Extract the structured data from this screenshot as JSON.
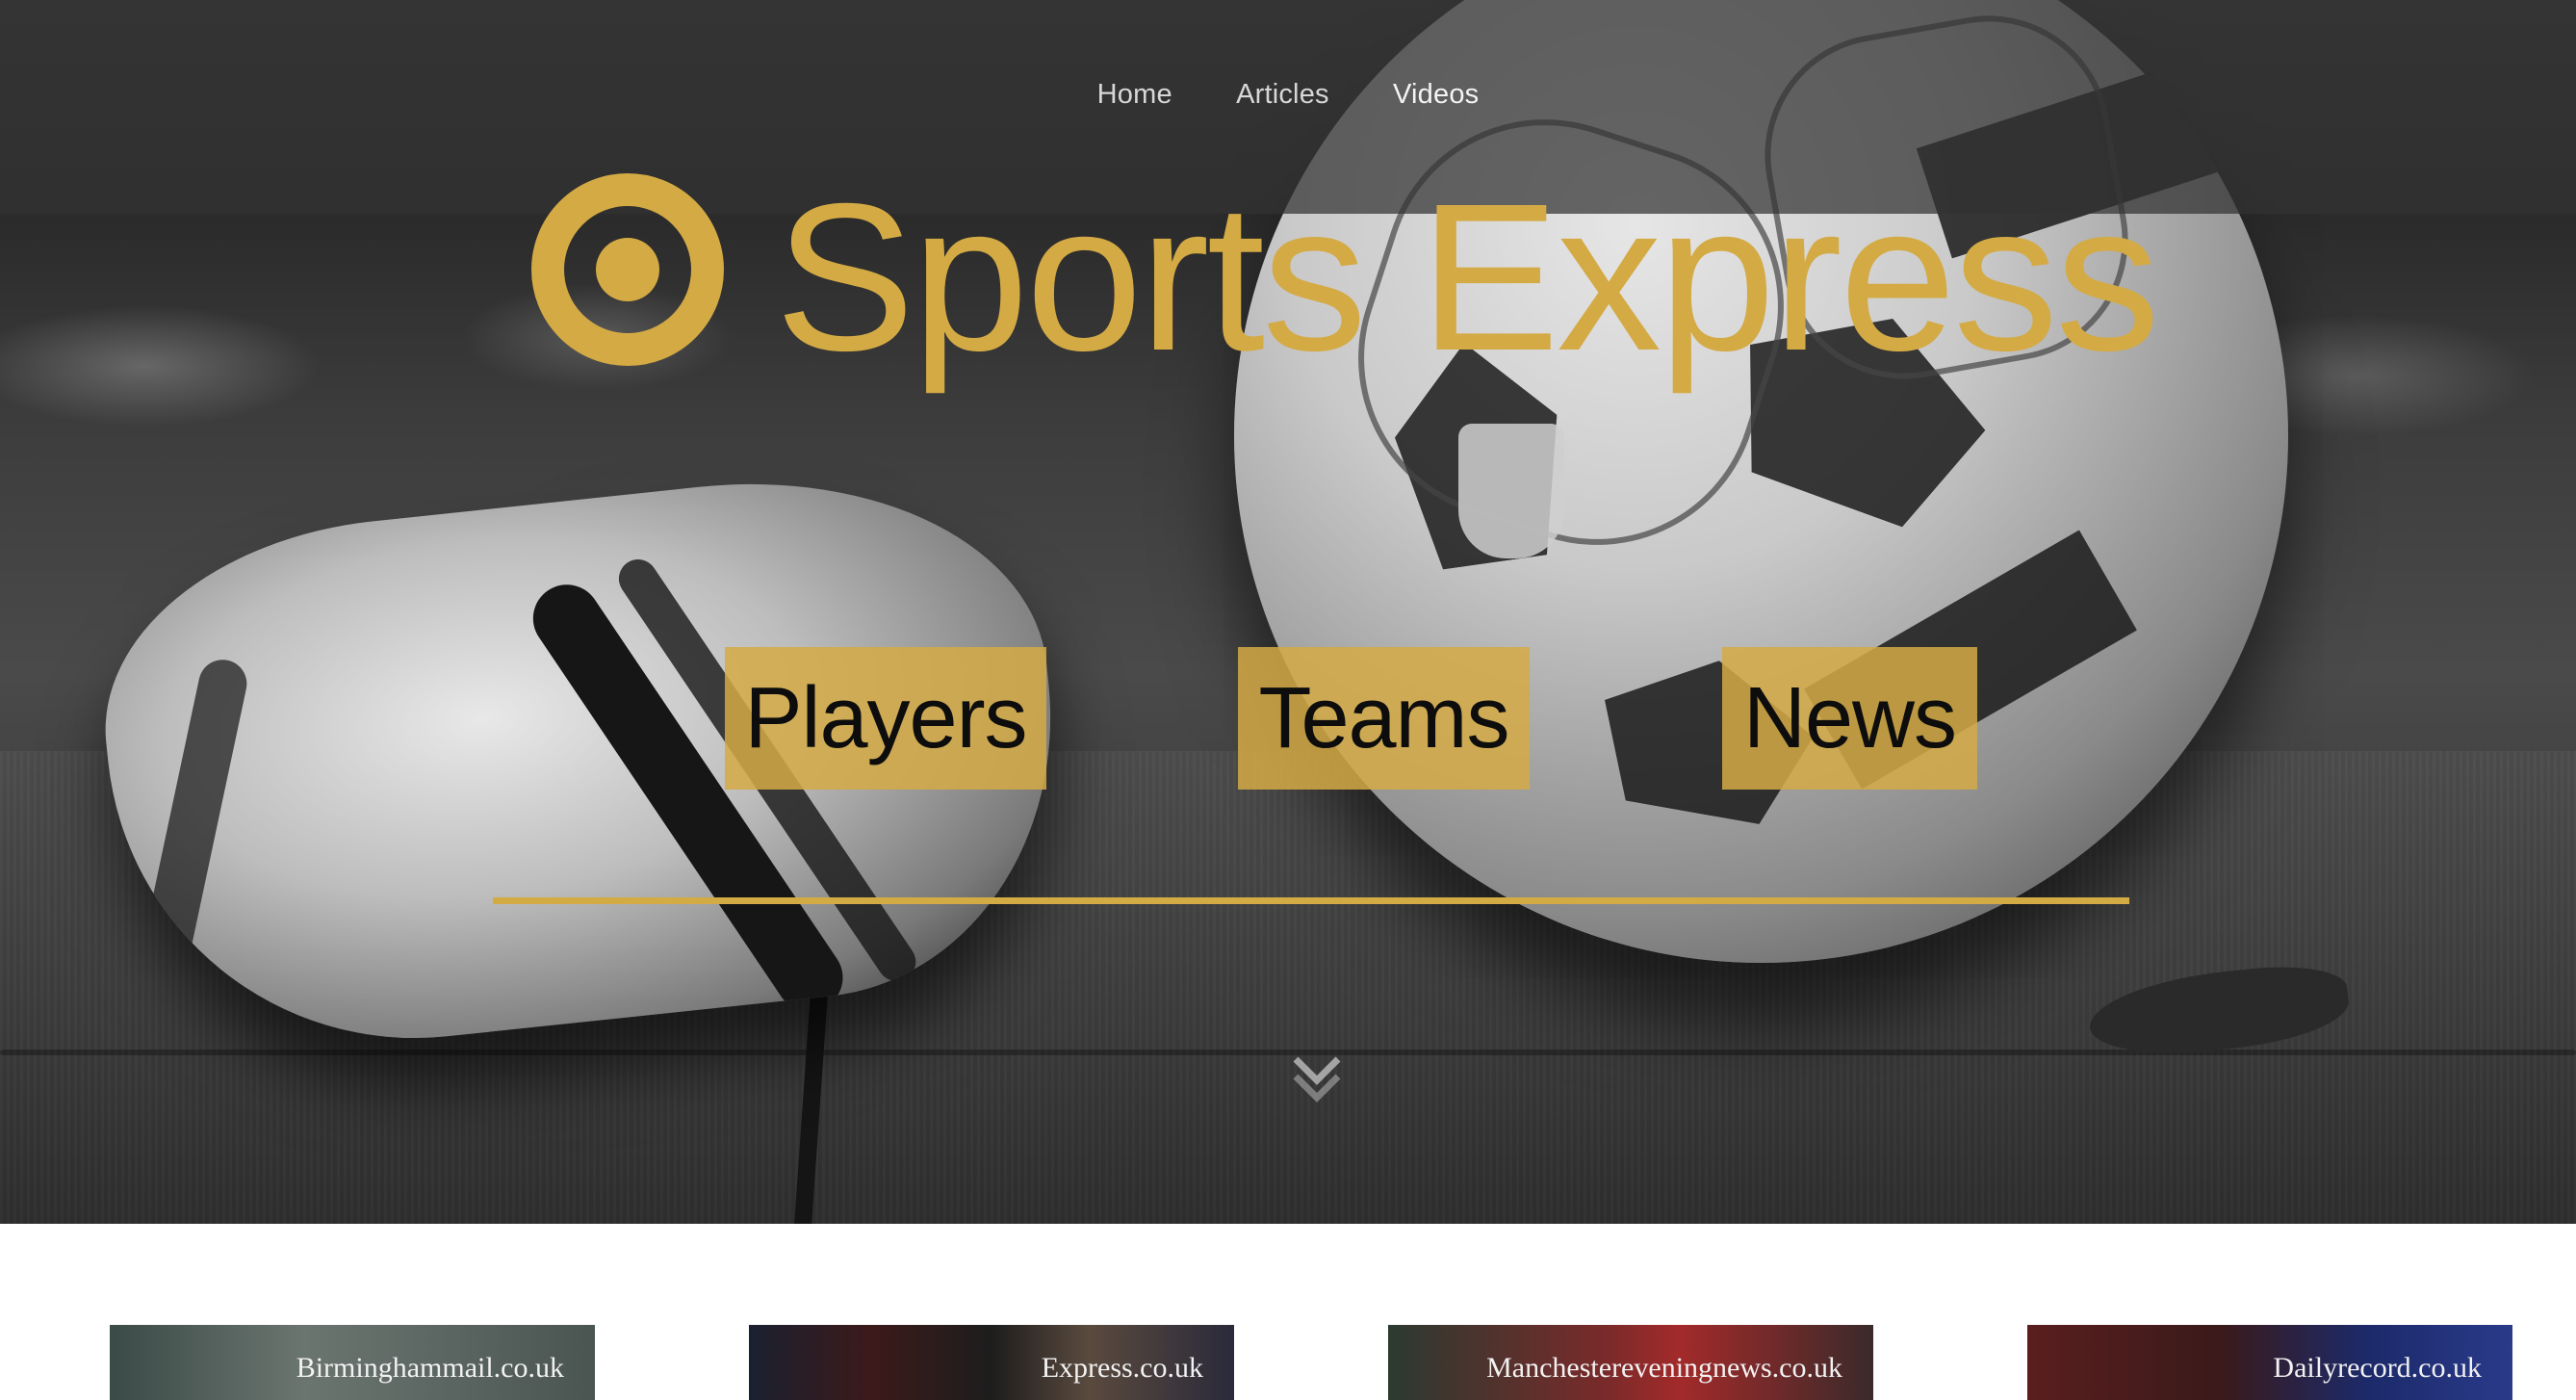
{
  "nav": {
    "items": [
      {
        "label": "Home"
      },
      {
        "label": "Articles"
      },
      {
        "label": "Videos"
      }
    ]
  },
  "brand": {
    "title": "Sports Express",
    "logo_icon": "target-icon",
    "accent_color": "#d4aa44"
  },
  "categories": [
    {
      "label": "Players"
    },
    {
      "label": "Teams"
    },
    {
      "label": "News"
    }
  ],
  "scroll_icon": "chevron-down-icon",
  "sources": [
    {
      "label": "Birminghammail.co.uk"
    },
    {
      "label": "Express.co.uk"
    },
    {
      "label": "Manchestereveningnews.co.uk"
    },
    {
      "label": "Dailyrecord.co.uk"
    }
  ]
}
